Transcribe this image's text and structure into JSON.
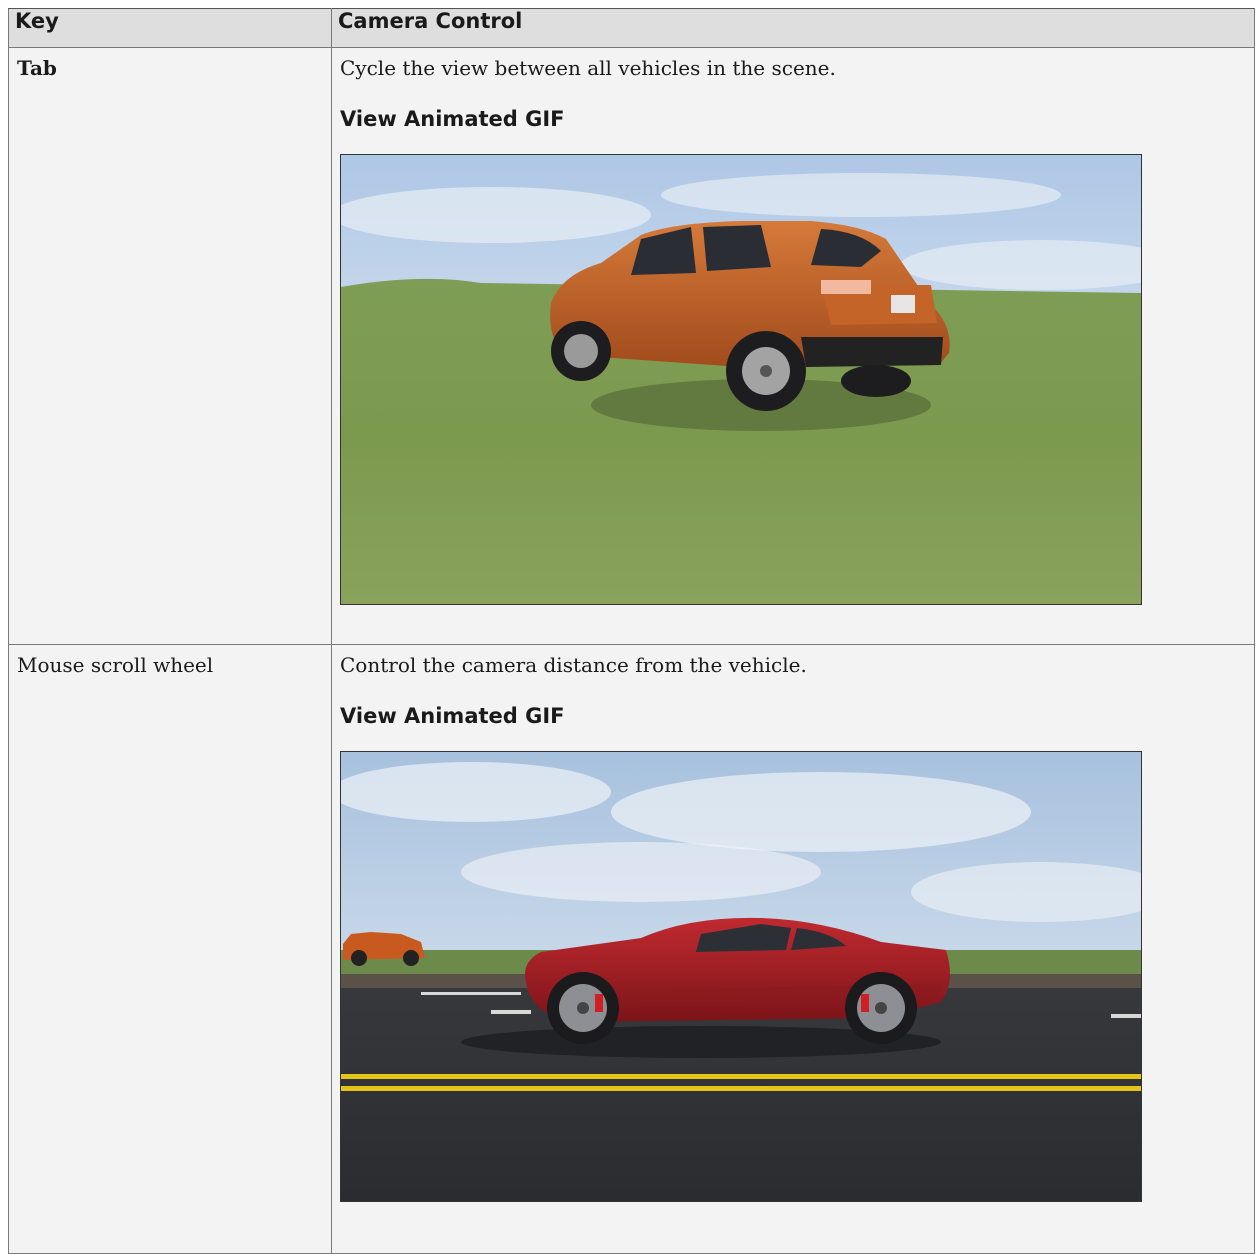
{
  "table": {
    "headers": {
      "key": "Key",
      "control": "Camera Control"
    },
    "rows": [
      {
        "key": "Tab",
        "description": "Cycle the view between all vehicles in the scene.",
        "link": "View Animated GIF",
        "image": "orange-suv-on-grass"
      },
      {
        "key": "Mouse scroll wheel",
        "description": "Control the camera distance from the vehicle.",
        "link": "View Animated GIF",
        "image": "red-sports-car-on-road"
      }
    ]
  },
  "colors": {
    "header_bg": "#dedede",
    "cell_bg": "#f3f3f3",
    "border": "#7a7a7a"
  }
}
